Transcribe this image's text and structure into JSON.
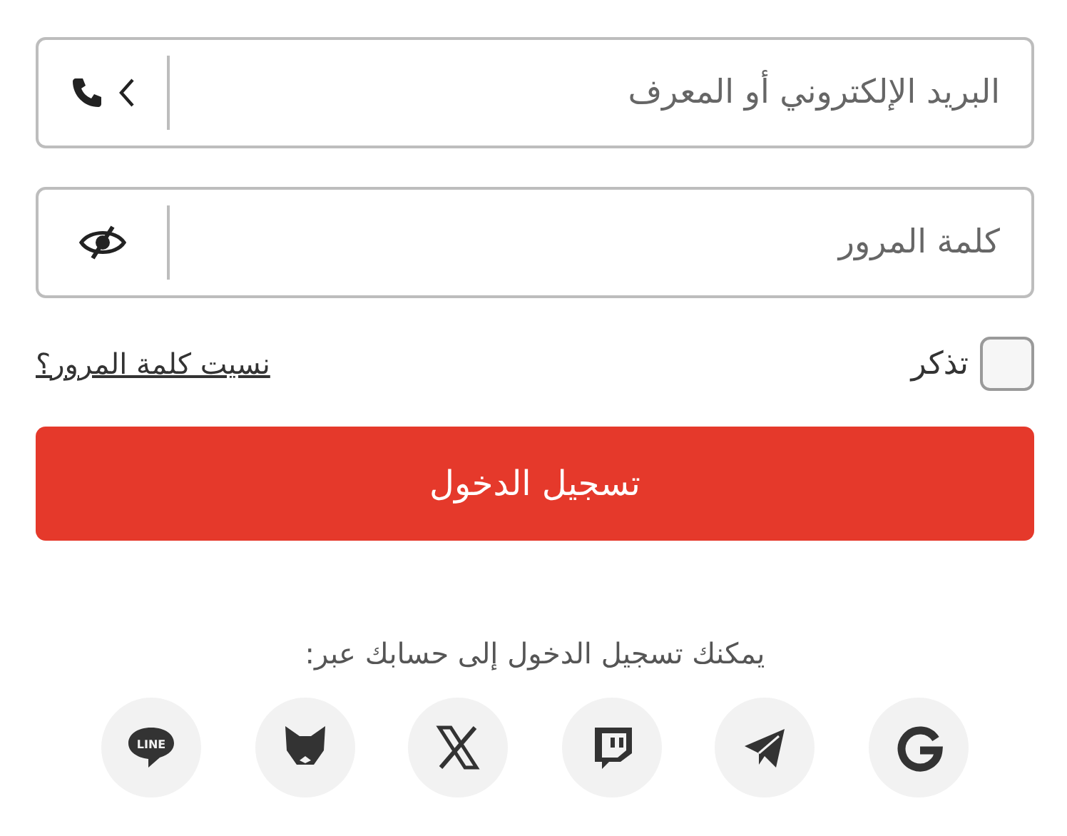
{
  "login_form": {
    "identifier_field": {
      "placeholder": "البريد الإلكتروني أو المعرف"
    },
    "password_field": {
      "placeholder": "كلمة المرور"
    },
    "remember_me": {
      "label": "تذكر",
      "checked": false
    },
    "forgot_password": "نسيت كلمة المرور؟",
    "submit_button": "تسجيل الدخول",
    "social_prompt": "يمكنك تسجيل الدخول إلى حسابك عبر:",
    "social_logins": [
      {
        "kind": "google"
      },
      {
        "kind": "telegram"
      },
      {
        "kind": "twitch"
      },
      {
        "kind": "x"
      },
      {
        "kind": "fox"
      },
      {
        "kind": "line",
        "text": "LINE"
      }
    ]
  }
}
